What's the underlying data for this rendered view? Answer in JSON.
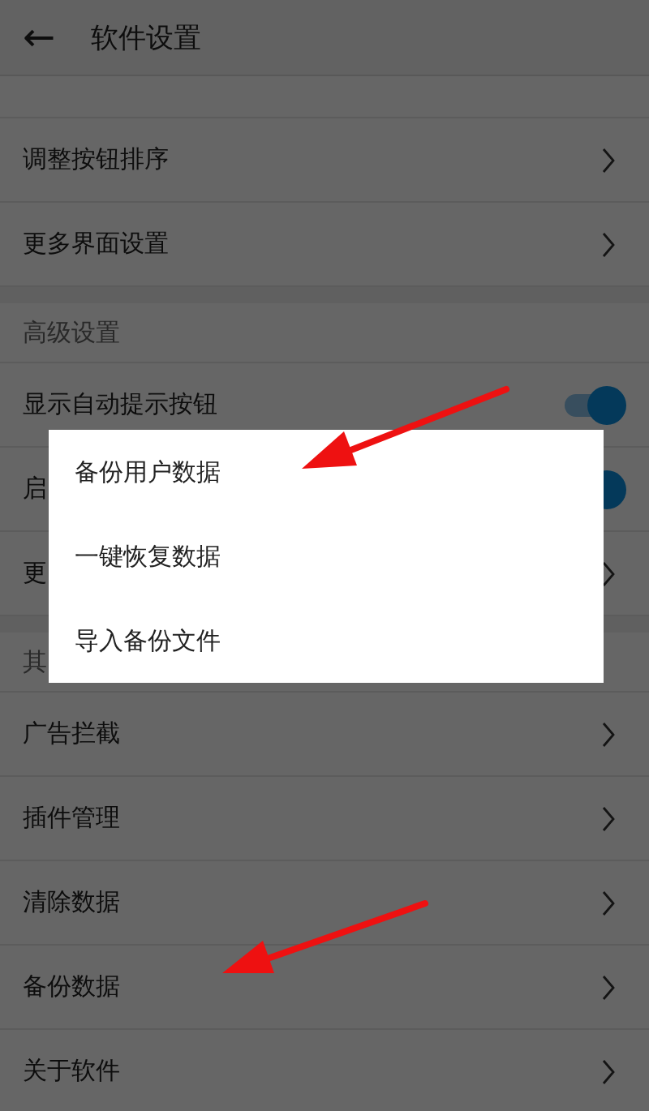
{
  "header": {
    "back": "←",
    "title": "软件设置"
  },
  "groups": [
    {
      "rows": [
        {
          "kind": "link",
          "label": "调整按钮排序"
        },
        {
          "kind": "link",
          "label": "更多界面设置"
        }
      ]
    },
    {
      "title": "高级设置",
      "rows": [
        {
          "kind": "toggle",
          "label": "显示自动提示按钮",
          "on": true
        },
        {
          "kind": "toggle",
          "label": "启",
          "on": true
        },
        {
          "kind": "link",
          "label": "更"
        }
      ]
    },
    {
      "title": "其",
      "rows": [
        {
          "kind": "link",
          "label": "广告拦截"
        },
        {
          "kind": "link",
          "label": "插件管理"
        },
        {
          "kind": "link",
          "label": "清除数据"
        },
        {
          "kind": "link",
          "label": "备份数据"
        },
        {
          "kind": "link",
          "label": "关于软件"
        }
      ]
    }
  ],
  "popup": {
    "items": [
      "备份用户数据",
      "一键恢复数据",
      "导入备份文件"
    ]
  }
}
